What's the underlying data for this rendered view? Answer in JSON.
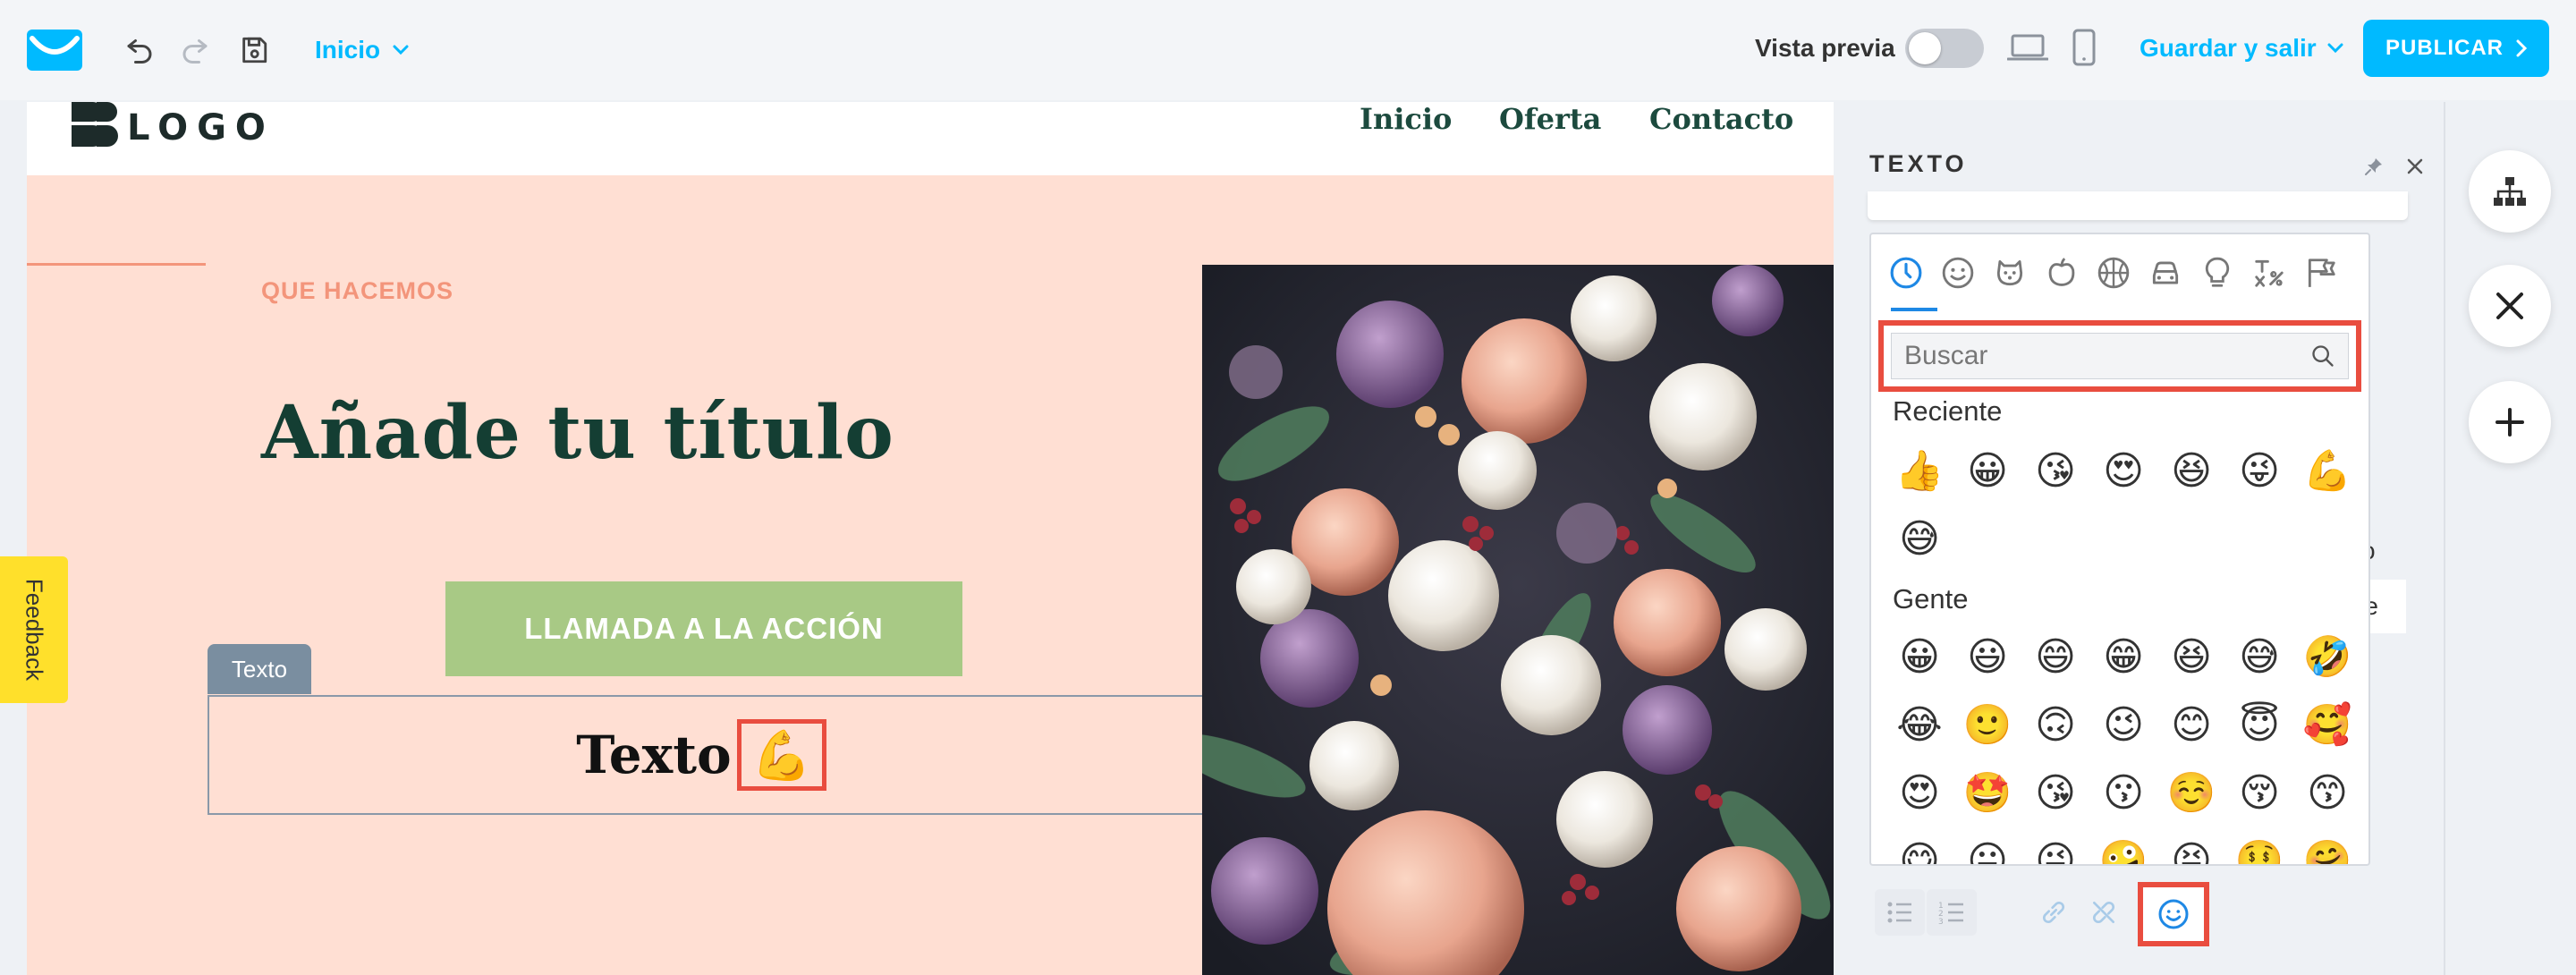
{
  "topbar": {
    "page_selector": "Inicio",
    "preview_label": "Vista previa",
    "save_exit_label": "Guardar y salir",
    "publish_label": "PUBLICAR"
  },
  "site": {
    "logo_text": "LOGO",
    "nav": [
      "Inicio",
      "Oferta",
      "Contacto"
    ],
    "eyebrow": "QUE HACEMOS",
    "title": "Añade tu título",
    "cta_label": "LLAMADA A LA ACCIÓN",
    "text_tag": "Texto",
    "text_content": "Texto",
    "text_emoji": "💪"
  },
  "feedback_label": "Feedback",
  "panel": {
    "title": "TEXTO",
    "peek_text_1": "o",
    "peek_text_2": "nte",
    "emoji_picker": {
      "search_placeholder": "Buscar",
      "recent_label": "Reciente",
      "recent": [
        "👍",
        "😀",
        "😘",
        "😍",
        "😆",
        "😜",
        "💪",
        "😅"
      ],
      "people_label": "Gente",
      "people": [
        "😀",
        "😃",
        "😄",
        "😁",
        "😆",
        "😅",
        "🤣",
        "😂",
        "🙂",
        "🙃",
        "😉",
        "😊",
        "😇",
        "🥰",
        "😍",
        "🤩",
        "😘",
        "😗",
        "☺️",
        "😚",
        "😙",
        "😋",
        "😛",
        "😜",
        "🤪",
        "😝",
        "🤑",
        "🤗"
      ]
    }
  },
  "colors": {
    "accent": "#00baff",
    "highlight": "#e94d3f",
    "hero_bg": "#ffdfd3",
    "title_green": "#143e33",
    "cta_green": "#a8c985",
    "feedback_yellow": "#ffe02b"
  }
}
